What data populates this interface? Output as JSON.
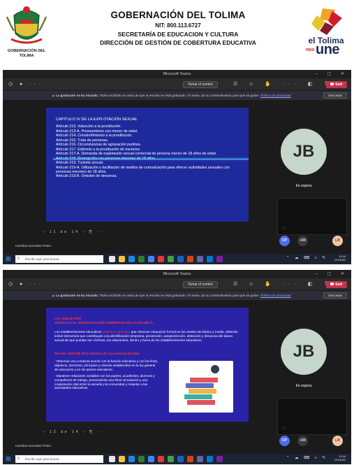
{
  "letterhead": {
    "title": "GOBERNACIÓN DEL TOLIMA",
    "nit": "NIT: 800.113.6727",
    "secretaria": "SECRETARÍA DE EDUCACION Y CULTURA",
    "direccion": "DIRECCIÓN DE GESTIÓN DE COBERTURA EDUCATIVA",
    "left_logo_label": "GOBERNACIÓN DEL TOLIMA",
    "brand": {
      "line1": "el Tolima",
      "line2_small": "nos",
      "line2_big": "une"
    }
  },
  "teams": {
    "window_title": "Microsoft Teams",
    "control_button": "Tomar el control",
    "leave_button": "Salir",
    "notice_prefix": "La grabación se ha iniciado.",
    "notice_text": "Todos recibirán un aviso de que la reunión se está grabando. Al unirse, da su consentimiento para que se grabe.",
    "notice_link": "Política de privacidad",
    "dismiss_button": "Descartar",
    "presenter": "Carolina Gonzalez Prieto",
    "slide_nav": "11 de 14",
    "slide_nav_2": "12 de 14",
    "main_participant_initials": "JB",
    "waiting_label": "En espera",
    "participants": [
      {
        "initials": "CP"
      },
      {
        "initials": "+84"
      },
      {
        "initials": "LR"
      }
    ],
    "taskbar_search": "Escribe aquí para buscar",
    "clock_time": "10:16",
    "clock_date": "7/11/2022"
  },
  "slide1": {
    "heading": "CAPITULO IV DE LA EXPLOTACIÓN SEXUAL",
    "lines": [
      "Artículo 213. Inducción a la prostitución.",
      "Artículo 213-A. Proxenetismo con menor de edad.",
      "Artículo 214. Constreñimiento a la prostitución.",
      "Artículo 215. Trata de personas.",
      "Artículo 216. Circunstancias de agravación punitiva.",
      "Artículo 217. Estímulo a la prostitución de menores.",
      "Artículo 217-A. Demanda de explotación sexual comercial de persona menor de 18 años de edad.",
      "Artículo 218. Pornografía con personas menores de 18 años.",
      "Artículo 219. Turismo sexual.",
      "Artículo 219-A. Utilización o facilitación de medios de comunicación para ofrecer actividades sexuales con personas menores de 18 años.",
      "Artículo 219-B. Omisión de denuncia."
    ]
  },
  "slide2": {
    "title_line1": "Ley 1146 de 2007",
    "title_line2": "ARTICULO 11. IDENTIFICACIÓN TEMPRANA EN LA ESCUELA.",
    "intro_a": "Los establecimientos educativos",
    "intro_red": "oficiales y privados",
    "intro_b": "que ofrezcan educación formal en los niveles de básica y media, deberán incluir elementos que contribuyan a la identificación temprana, prevención, autoprotección, detección y denuncia del abuso sexual de que puedan ser víctimas, los educandos, dentro y fuera de los establecimientos educativos.",
    "subheading": "Decreto 1075 DE 2015 Sistema de Convivencia Escolar",
    "bullets": [
      "- Observar una conducta acorde con la función educativa y con los fines, objetivos, derechos, principios y criterios establecidos en la ley general de educación y en los planes educativos;",
      "- Mantener relaciones cordiales con los padres, acudientes, alumnos y compañeros de trabajo, promoviendo una firme vinculación y una cooperación vital entre la escuela y la comunidad y respetar a las autoridades educativas."
    ]
  }
}
